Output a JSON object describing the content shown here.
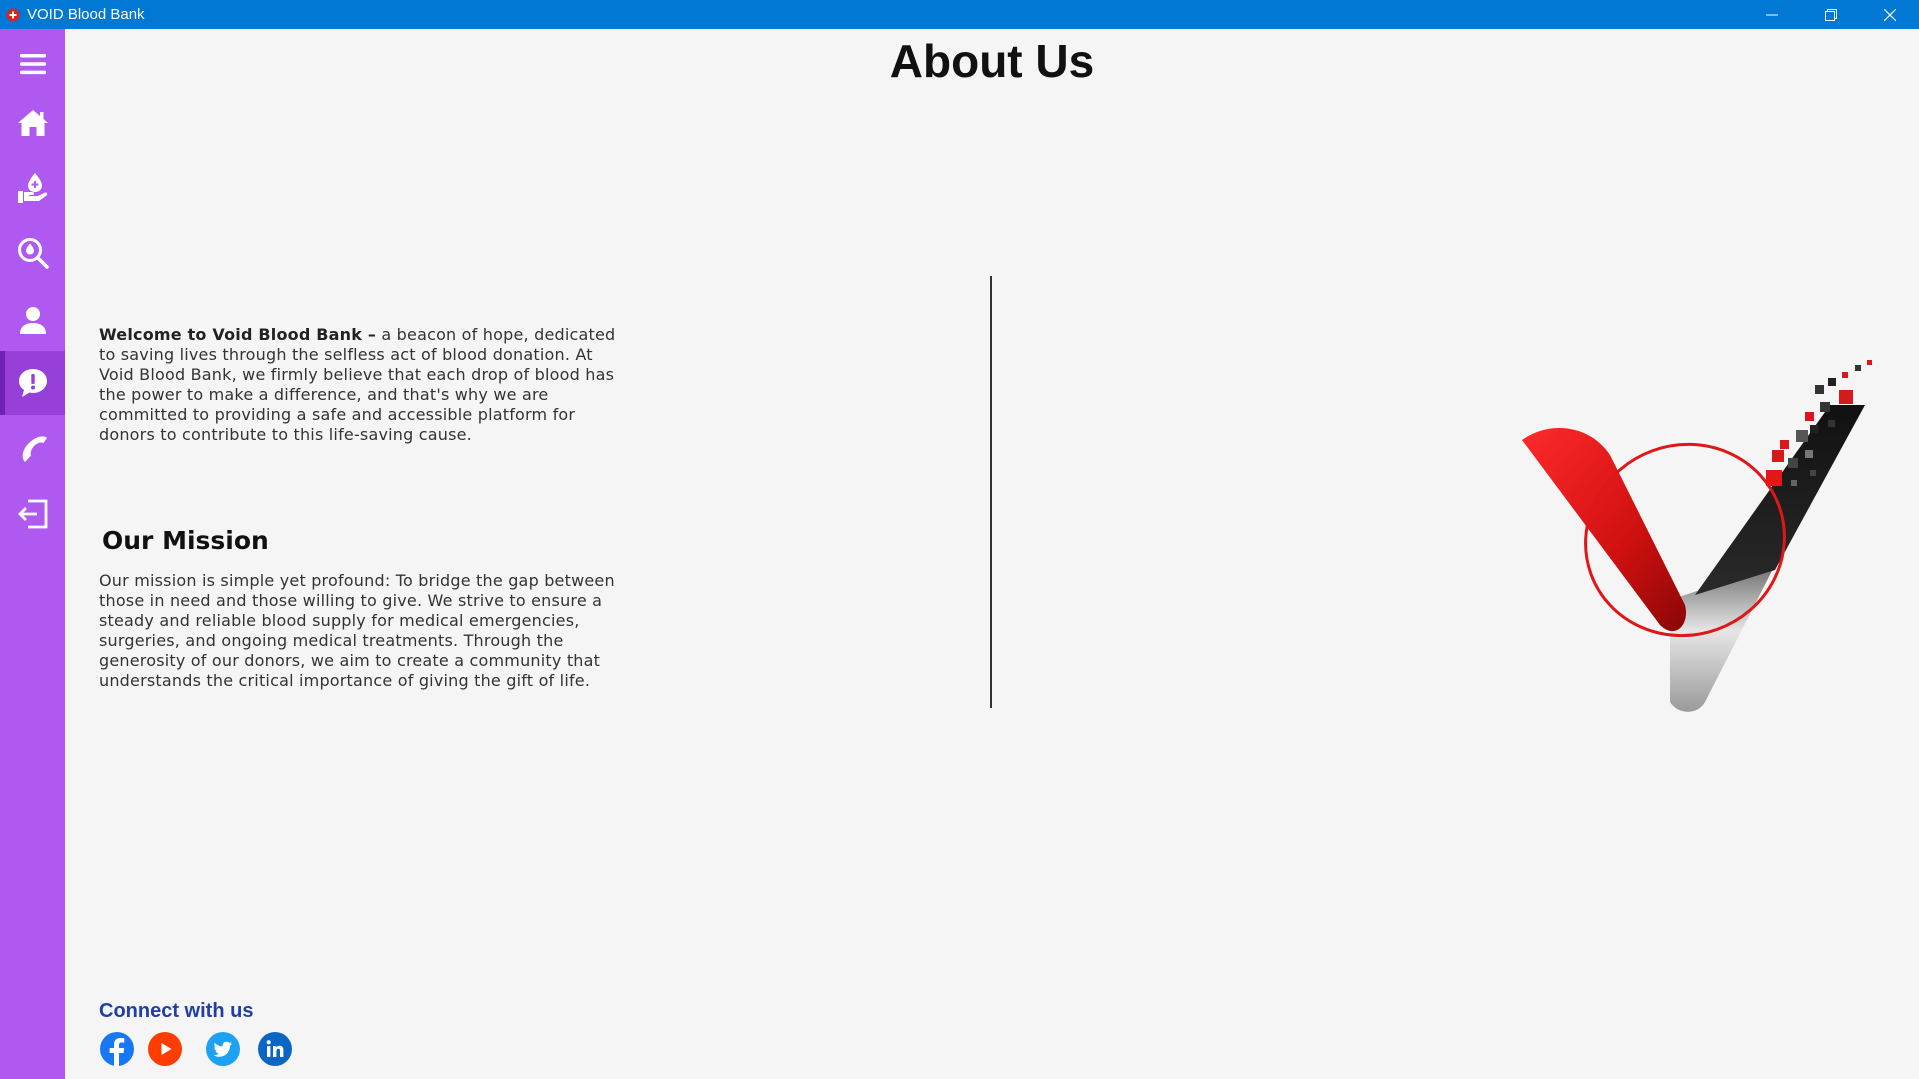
{
  "window": {
    "title": "VOID Blood Bank",
    "accent_color": "#0078d4"
  },
  "sidebar": {
    "background": "#b059f0",
    "items": [
      {
        "icon": "menu-icon",
        "active": false
      },
      {
        "icon": "home-icon",
        "active": false
      },
      {
        "icon": "donate-blood-icon",
        "active": false
      },
      {
        "icon": "search-blood-icon",
        "active": false
      },
      {
        "icon": "user-icon",
        "active": false
      },
      {
        "icon": "about-chat-icon",
        "active": true
      },
      {
        "icon": "phone-icon",
        "active": false
      },
      {
        "icon": "logout-icon",
        "active": false
      }
    ]
  },
  "page": {
    "title": "About Us",
    "intro_bold": "Welcome to Void Blood Bank –",
    "intro_text": " a beacon of hope, dedicated to saving lives through the selfless act of blood donation. At Void Blood Bank, we firmly believe that each drop of blood has the power to make a difference, and that's why we are committed to providing a safe and accessible platform for donors to contribute to this life-saving cause.",
    "mission_heading": "Our Mission",
    "mission_text": "Our mission is simple yet profound: To bridge the gap between those in need and those willing to give. We strive to ensure a steady and reliable blood supply for medical emergencies, surgeries, and ongoing medical treatments. Through the generosity of our donors, we aim to create a community that understands the critical importance of giving the gift of life."
  },
  "footer": {
    "connect_heading": "Connect with us",
    "socials": [
      {
        "icon": "facebook-icon",
        "color": "#1877f2"
      },
      {
        "icon": "youtube-icon",
        "color": "#ff3d00"
      },
      {
        "icon": "twitter-icon",
        "color": "#1da1f2"
      },
      {
        "icon": "linkedin-icon",
        "color": "#0a66c2"
      }
    ]
  }
}
